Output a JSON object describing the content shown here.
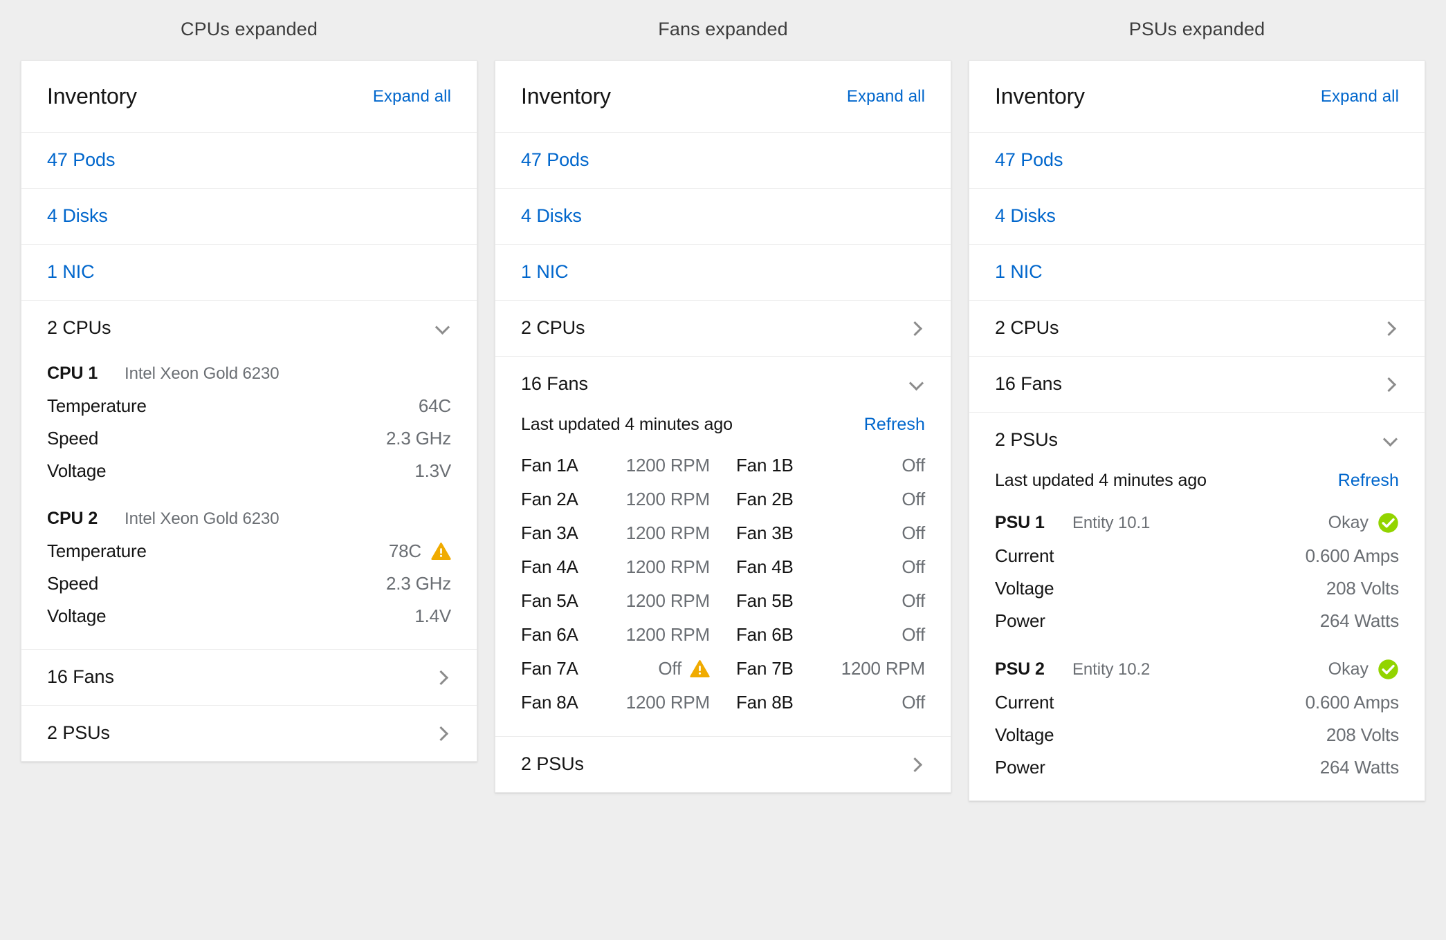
{
  "colors": {
    "link": "#0066cc",
    "warning": "#f0ab00",
    "success": "#92d400",
    "text": "#151515",
    "muted": "#6a6e73",
    "page_bg": "#eeeeee"
  },
  "columns": [
    {
      "caption": "CPUs expanded",
      "header": {
        "title": "Inventory",
        "expand_all": "Expand all"
      },
      "links": [
        {
          "label": "47 Pods"
        },
        {
          "label": "4 Disks"
        },
        {
          "label": "1 NIC"
        }
      ],
      "groups": [
        {
          "label": "2 CPUs",
          "state": "expanded",
          "icon": "chevron-down-icon",
          "body": "cpus",
          "cpus": [
            {
              "name": "CPU 1",
              "model": "Intel Xeon Gold 6230",
              "rows": [
                {
                  "key": "Temperature",
                  "value": "64C",
                  "status": "none"
                },
                {
                  "key": "Speed",
                  "value": "2.3 GHz",
                  "status": "none"
                },
                {
                  "key": "Voltage",
                  "value": "1.3V",
                  "status": "none"
                }
              ]
            },
            {
              "name": "CPU 2",
              "model": "Intel Xeon Gold 6230",
              "rows": [
                {
                  "key": "Temperature",
                  "value": "78C",
                  "status": "warning"
                },
                {
                  "key": "Speed",
                  "value": "2.3 GHz",
                  "status": "none"
                },
                {
                  "key": "Voltage",
                  "value": "1.4V",
                  "status": "none"
                }
              ]
            }
          ]
        },
        {
          "label": "16 Fans",
          "state": "collapsed",
          "icon": "chevron-right-icon",
          "body": "none"
        },
        {
          "label": "2 PSUs",
          "state": "collapsed",
          "icon": "chevron-right-icon",
          "body": "none"
        }
      ]
    },
    {
      "caption": "Fans expanded",
      "header": {
        "title": "Inventory",
        "expand_all": "Expand all"
      },
      "links": [
        {
          "label": "47 Pods"
        },
        {
          "label": "4 Disks"
        },
        {
          "label": "1 NIC"
        }
      ],
      "groups": [
        {
          "label": "2 CPUs",
          "state": "collapsed",
          "icon": "chevron-right-icon",
          "body": "none"
        },
        {
          "label": "16 Fans",
          "state": "expanded",
          "icon": "chevron-down-icon",
          "body": "fans",
          "meta": {
            "text": "Last updated 4 minutes ago",
            "action": "Refresh"
          },
          "fans": [
            {
              "name": "Fan 1A",
              "value": "1200 RPM",
              "status": "none"
            },
            {
              "name": "Fan 1B",
              "value": "Off",
              "status": "none"
            },
            {
              "name": "Fan 2A",
              "value": "1200 RPM",
              "status": "none"
            },
            {
              "name": "Fan 2B",
              "value": "Off",
              "status": "none"
            },
            {
              "name": "Fan 3A",
              "value": "1200 RPM",
              "status": "none"
            },
            {
              "name": "Fan 3B",
              "value": "Off",
              "status": "none"
            },
            {
              "name": "Fan 4A",
              "value": "1200 RPM",
              "status": "none"
            },
            {
              "name": "Fan 4B",
              "value": "Off",
              "status": "none"
            },
            {
              "name": "Fan 5A",
              "value": "1200 RPM",
              "status": "none"
            },
            {
              "name": "Fan 5B",
              "value": "Off",
              "status": "none"
            },
            {
              "name": "Fan 6A",
              "value": "1200 RPM",
              "status": "none"
            },
            {
              "name": "Fan 6B",
              "value": "Off",
              "status": "none"
            },
            {
              "name": "Fan 7A",
              "value": "Off",
              "status": "warning"
            },
            {
              "name": "Fan 7B",
              "value": "1200 RPM",
              "status": "none"
            },
            {
              "name": "Fan 8A",
              "value": "1200 RPM",
              "status": "none"
            },
            {
              "name": "Fan 8B",
              "value": "Off",
              "status": "none"
            }
          ]
        },
        {
          "label": "2 PSUs",
          "state": "collapsed",
          "icon": "chevron-right-icon",
          "body": "none"
        }
      ]
    },
    {
      "caption": "PSUs expanded",
      "header": {
        "title": "Inventory",
        "expand_all": "Expand all"
      },
      "links": [
        {
          "label": "47 Pods"
        },
        {
          "label": "4 Disks"
        },
        {
          "label": "1 NIC"
        }
      ],
      "groups": [
        {
          "label": "2 CPUs",
          "state": "collapsed",
          "icon": "chevron-right-icon",
          "body": "none"
        },
        {
          "label": "16 Fans",
          "state": "collapsed",
          "icon": "chevron-right-icon",
          "body": "none"
        },
        {
          "label": "2 PSUs",
          "state": "expanded",
          "icon": "chevron-down-icon",
          "body": "psus",
          "meta": {
            "text": "Last updated 4 minutes ago",
            "action": "Refresh"
          },
          "psus": [
            {
              "name": "PSU 1",
              "entity": "Entity 10.1",
              "status_label": "Okay",
              "status": "ok",
              "rows": [
                {
                  "key": "Current",
                  "value": "0.600 Amps",
                  "status": "none"
                },
                {
                  "key": "Voltage",
                  "value": "208 Volts",
                  "status": "none"
                },
                {
                  "key": "Power",
                  "value": "264 Watts",
                  "status": "none"
                }
              ]
            },
            {
              "name": "PSU 2",
              "entity": "Entity 10.2",
              "status_label": "Okay",
              "status": "ok",
              "rows": [
                {
                  "key": "Current",
                  "value": "0.600 Amps",
                  "status": "none"
                },
                {
                  "key": "Voltage",
                  "value": "208 Volts",
                  "status": "none"
                },
                {
                  "key": "Power",
                  "value": "264 Watts",
                  "status": "none"
                }
              ]
            }
          ]
        }
      ]
    }
  ]
}
